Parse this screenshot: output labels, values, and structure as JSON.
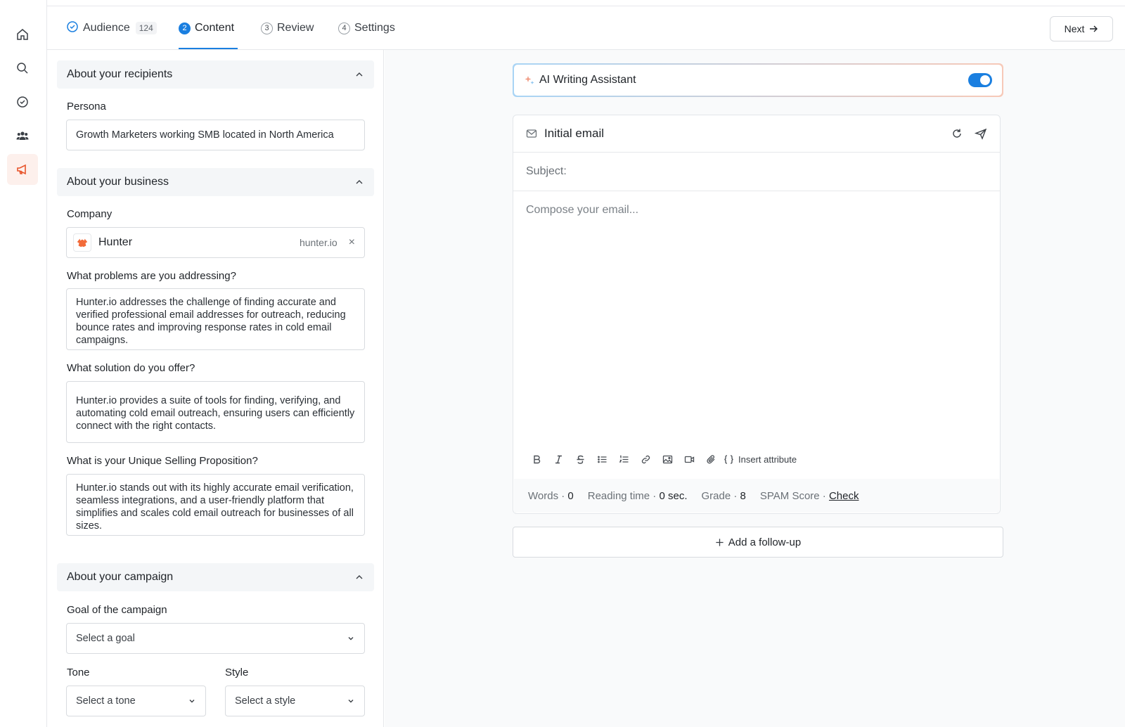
{
  "rail": {
    "items": [
      "home-icon",
      "search-icon",
      "check-circle-icon",
      "people-icon",
      "megaphone-icon"
    ],
    "active_color": "#e8542a"
  },
  "tabs": [
    {
      "label": "Audience",
      "badge": "124",
      "state": "done"
    },
    {
      "label": "Content",
      "num": "2",
      "state": "active"
    },
    {
      "label": "Review",
      "num": "3",
      "state": "todo"
    },
    {
      "label": "Settings",
      "num": "4",
      "state": "todo"
    }
  ],
  "next_label": "Next",
  "form": {
    "recipients": {
      "title": "About your recipients",
      "persona_label": "Persona",
      "persona_value": "Growth Marketers working SMB located in North America"
    },
    "business": {
      "title": "About your business",
      "company_label": "Company",
      "company_name": "Hunter",
      "company_domain": "hunter.io",
      "problems_label": "What problems are you addressing?",
      "problems_value": "Hunter.io addresses the challenge of finding accurate and verified professional email addresses for outreach, reducing bounce rates and improving response rates in cold email campaigns.",
      "solution_label": "What solution do you offer?",
      "solution_value": "Hunter.io provides a suite of tools for finding, verifying, and automating cold email outreach, ensuring users can efficiently connect with the right contacts.",
      "usp_label": "What is your Unique Selling Proposition?",
      "usp_value": "Hunter.io stands out with its highly accurate email verification, seamless integrations, and a user-friendly platform that simplifies and scales cold email outreach for businesses of all sizes."
    },
    "campaign": {
      "title": "About your campaign",
      "goal_label": "Goal of the campaign",
      "goal_placeholder": "Select a goal",
      "tone_label": "Tone",
      "tone_placeholder": "Select a tone",
      "style_label": "Style",
      "style_placeholder": "Select a style"
    }
  },
  "ai_assistant": {
    "label": "AI Writing Assistant",
    "enabled": true
  },
  "email": {
    "title": "Initial email",
    "subject_label": "Subject:",
    "body_placeholder": "Compose your email...",
    "toolbar": [
      "bold-icon",
      "italic-icon",
      "strikethrough-icon",
      "bullet-list-icon",
      "numbered-list-icon",
      "link-icon",
      "image-icon",
      "video-icon",
      "attachment-icon"
    ],
    "insert_attribute_label": "Insert attribute",
    "stats": {
      "words_label": "Words ·",
      "words_value": "0",
      "reading_label": "Reading time ·",
      "reading_value": "0 sec.",
      "grade_label": "Grade ·",
      "grade_value": "8",
      "spam_label": "SPAM Score ·",
      "spam_link": "Check"
    }
  },
  "followup_label": "Add a follow-up",
  "colors": {
    "accent": "#1a7fe0",
    "brand": "#e8542a"
  }
}
